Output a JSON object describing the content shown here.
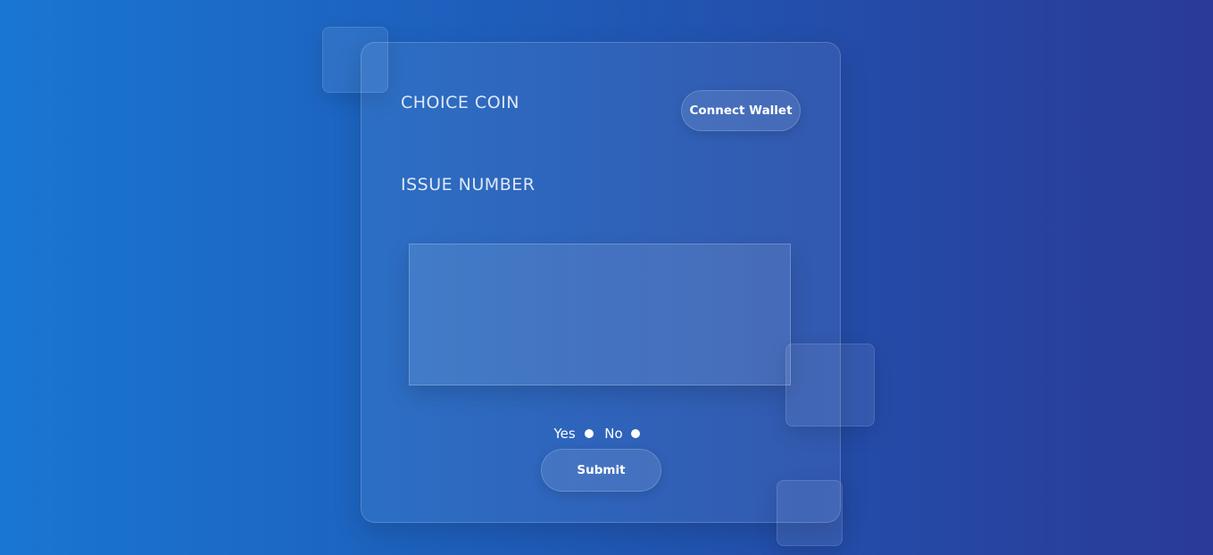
{
  "header": {
    "brand": "CHOICE COIN",
    "connect_wallet_label": "Connect Wallet"
  },
  "issue": {
    "title": "ISSUE NUMBER",
    "text_value": ""
  },
  "vote": {
    "options": [
      {
        "label": "Yes"
      },
      {
        "label": "No"
      }
    ]
  },
  "actions": {
    "submit_label": "Submit"
  },
  "colors": {
    "background_start": "#1976d2",
    "background_end": "#2a3a96",
    "text": "#ffffff"
  }
}
